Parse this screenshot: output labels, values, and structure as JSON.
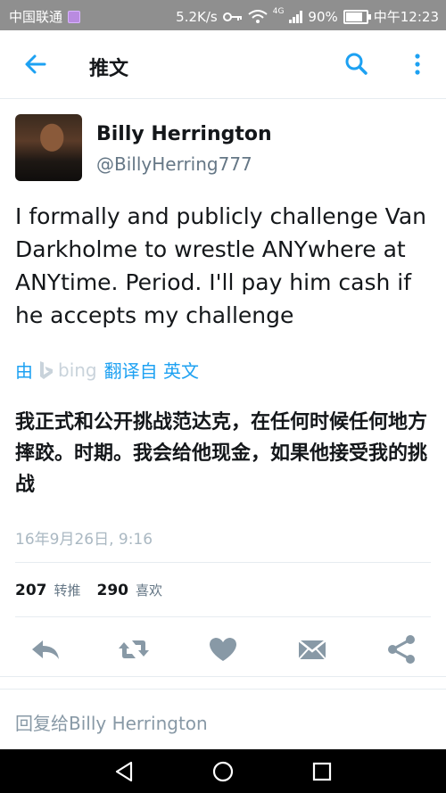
{
  "status_bar": {
    "carrier": "中国联通",
    "speed": "5.2K/s",
    "network": "4G",
    "battery": "90%",
    "time": "中午12:23"
  },
  "header": {
    "title": "推文",
    "icons": [
      "back-arrow-icon",
      "search-icon",
      "more-vertical-icon"
    ]
  },
  "tweet": {
    "author_name": "Billy Herrington",
    "author_handle": "@BillyHerring777",
    "text": "I formally and publicly challenge Van Darkholme to wrestle ANYwhere at ANYtime. Period. I'll pay him cash if he accepts my challenge",
    "translate_prefix": "由",
    "translate_provider": "bing",
    "translate_suffix": "翻译自 英文",
    "translated_text": "我正式和公开挑战范达克，在任何时候任何地方摔跤。时期。我会给他现金，如果他接受我的挑战",
    "timestamp": "16年9月26日, 9:16",
    "retweets": "207",
    "retweets_label": "转推",
    "likes": "290",
    "likes_label": "喜欢"
  },
  "actions": [
    "reply-icon",
    "retweet-icon",
    "like-icon",
    "message-icon",
    "share-icon"
  ],
  "reply": {
    "prefix": "回复给",
    "name": "Billy Herrington"
  },
  "colors": {
    "accent": "#1da1f2",
    "icon_gray": "#8899a6",
    "status_bar": "#8f8f8f"
  }
}
